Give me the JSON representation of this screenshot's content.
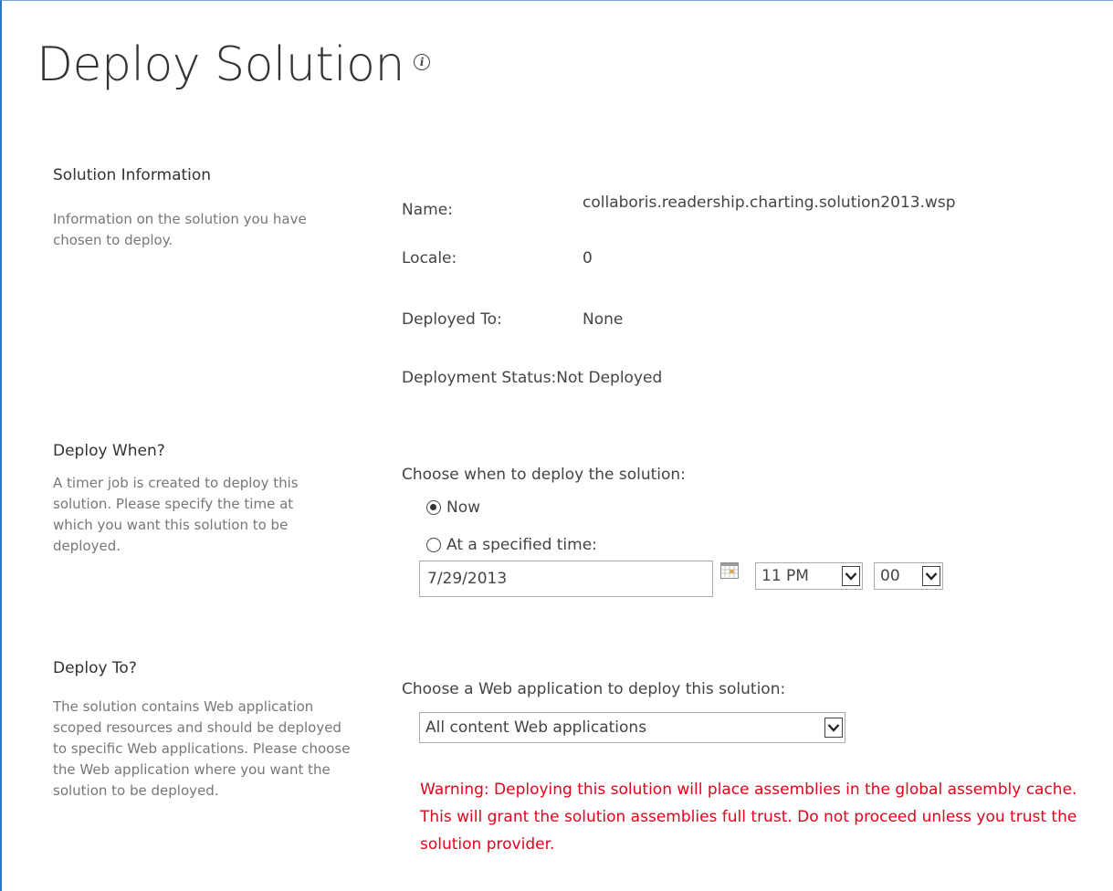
{
  "page": {
    "title": "Deploy Solution"
  },
  "solution_info": {
    "title": "Solution Information",
    "description": "Information on the solution you have chosen to deploy.",
    "fields": [
      {
        "label": "Name:",
        "value": "collaboris.readership.charting.solution2013.wsp"
      },
      {
        "label": "Locale:",
        "value": "0"
      },
      {
        "label": "Deployed To:",
        "value": "None"
      },
      {
        "label": "Deployment Status:",
        "value": "Not Deployed"
      }
    ]
  },
  "deploy_when": {
    "title": "Deploy When?",
    "description": "A timer job is created to deploy this solution. Please specify the time at which you want this solution to be deployed.",
    "prompt": "Choose when to deploy the solution:",
    "option_now": "Now",
    "option_specified": "At a specified time:",
    "selected": "now",
    "date_value": "7/29/2013",
    "hour_value": "11 PM",
    "minute_value": "00"
  },
  "deploy_to": {
    "title": "Deploy To?",
    "description": "The solution contains Web application scoped resources and should be deployed to specific Web applications. Please choose the Web application where you want the solution to be deployed.",
    "prompt": "Choose a Web application to deploy this solution:",
    "web_app_value": "All content Web applications",
    "warning": "Warning: Deploying this solution will place assemblies in the global assembly cache. This will grant the solution assemblies full trust. Do not proceed unless you trust the solution provider."
  },
  "colors": {
    "accent_border": "#2b79c2",
    "warning_text": "#e8001a"
  }
}
